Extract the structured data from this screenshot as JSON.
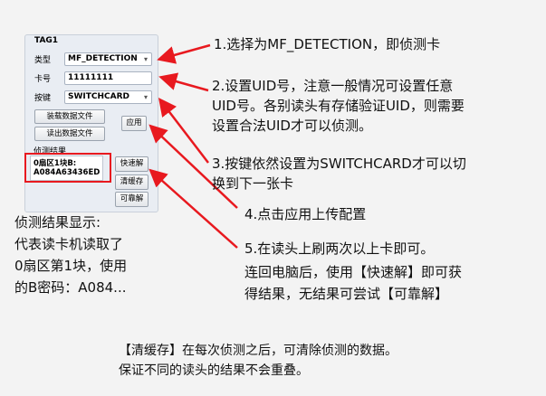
{
  "panel": {
    "title": "TAG1",
    "type_label": "类型",
    "type_value": "MF_DETECTION",
    "card_label": "卡号",
    "card_value": "11111111",
    "key_label": "按键",
    "key_value": "SWITCHCARD",
    "load_button": "装载数据文件",
    "read_button": "读出数据文件",
    "apply_button": "应用",
    "result_label": "侦测结果",
    "result_line1": "0扇区1块B:",
    "result_line2": "A084A63436ED",
    "quick_button": "快速解",
    "clear_button": "清缓存",
    "reliable_button": "可靠解"
  },
  "steps": {
    "s1": "1.选择为MF_DETECTION，即侦测卡",
    "s2_l1": "2.设置UID号，注意一般情况可设置任意",
    "s2_l2": "UID号。各别读头有存储验证UID，则需要",
    "s2_l3": "设置合法UID才可以侦测。",
    "s3_l1": "3.按键依然设置为SWITCHCARD才可以切",
    "s3_l2": "换到下一张卡",
    "s4": "4.点击应用上传配置",
    "s5_l1": "5.在读头上刷两次以上卡即可。",
    "s5_l2": "连回电脑后，使用【快速解】即可获",
    "s5_l3": "得结果，无结果可尝试【可靠解】"
  },
  "left_note": {
    "l1": "侦测结果显示:",
    "l2": "代表读卡机读取了",
    "l3": "0扇区第1块，使用",
    "l4": "的B密码：A084..."
  },
  "bottom_note": {
    "l1": "【清缓存】在每次侦测之后，可清除侦测的数据。",
    "l2": "保证不同的读头的结果不会重叠。"
  },
  "colors": {
    "arrow": "#e8191f",
    "panel_bg": "#e9edf3"
  },
  "icons": {
    "dropdown": "chevron-down-icon"
  }
}
